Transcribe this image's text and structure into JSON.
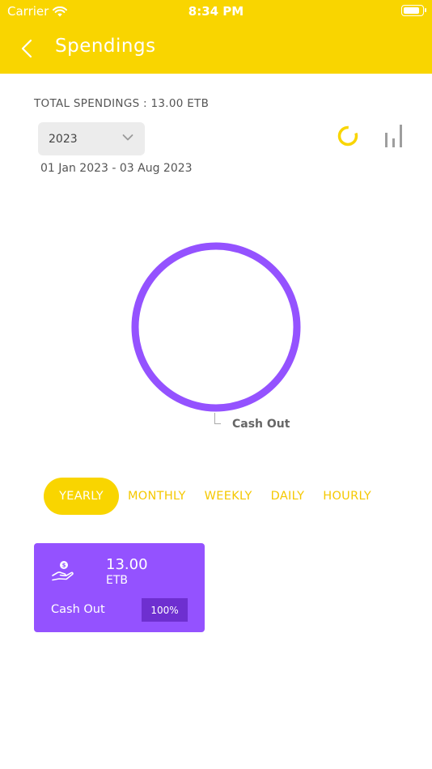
{
  "status_bar": {
    "carrier": "Carrier",
    "time": "8:34 PM",
    "battery_level": 0.9
  },
  "header": {
    "title": "Spendings"
  },
  "summary": {
    "total": "TOTAL SPENDINGS : 13.00 ETB",
    "year": "2023",
    "range": "01 Jan 2023 - 03 Aug 2023"
  },
  "icons": {
    "back": "chevron-left-icon",
    "select": "chevron-down-icon",
    "pie_toggle": "donut-chart-icon",
    "bar_toggle": "bar-chart-icon",
    "card": "money-hand-icon"
  },
  "colors": {
    "accent": "#F9D500",
    "cash_out": "#9452FF",
    "badge": "#6E2FD0",
    "inactive_toggle": "#9e9e9e"
  },
  "chart_data": {
    "type": "pie",
    "style": "donut",
    "categories": [
      "Cash Out"
    ],
    "values": [
      13.0
    ],
    "colors": [
      "#9452FF"
    ]
  },
  "tabs": [
    {
      "label": "YEARLY",
      "active": true
    },
    {
      "label": "MONTHLY",
      "active": false
    },
    {
      "label": "WEEKLY",
      "active": false
    },
    {
      "label": "DAILY",
      "active": false
    },
    {
      "label": "HOURLY",
      "active": false
    }
  ],
  "cards": [
    {
      "amount": "13.00",
      "currency": "ETB",
      "name": "Cash Out",
      "percent": "100%"
    }
  ]
}
